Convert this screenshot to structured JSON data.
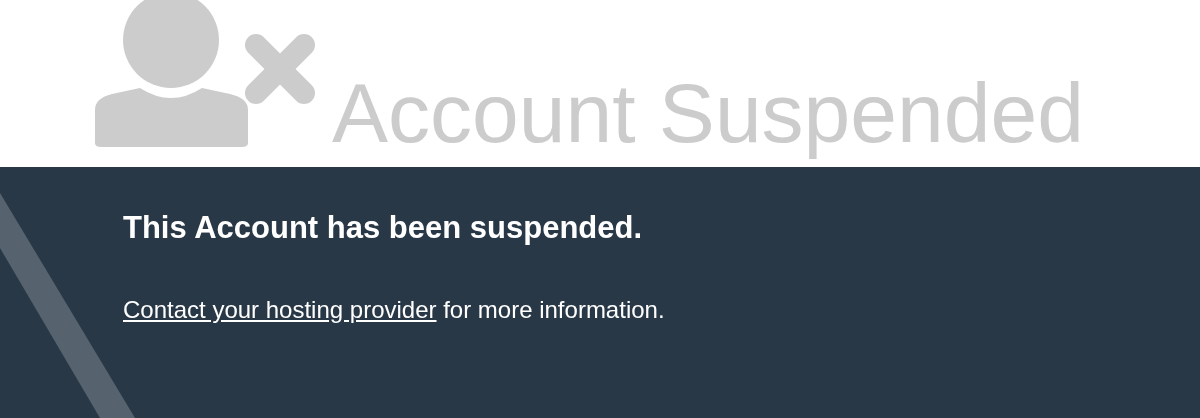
{
  "header": {
    "title": "Account Suspended"
  },
  "notice": {
    "heading": "This Account has been suspended.",
    "link": "Contact your hosting provider",
    "rest": " for more information."
  }
}
